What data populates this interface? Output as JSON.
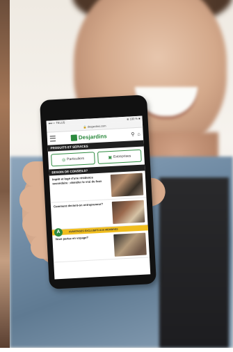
{
  "phone_screen": {
    "status_left": "●●○○ TELUS ",
    "status_right": "⊕ 100 % ■",
    "url": "🔒 desjardins.com",
    "brand": "Desjardins",
    "products_header": "PRODUITS ET SERVICES",
    "segments": [
      {
        "label": "Particuliers",
        "icon": "person-icon"
      },
      {
        "label": "Entreprises",
        "icon": "briefcase-icon"
      }
    ],
    "advice_header": "BESOIN DE CONSEILS?",
    "articles": [
      {
        "title": "Impôt et logé d'une résidence secondaire : démêler le vrai du faux"
      },
      {
        "title": "Comment devient-on entrepreneur?"
      },
      {
        "title": "Vous partez en voyage?"
      }
    ],
    "banner_badge": "A",
    "banner_text": "AVANTAGES EXCLUSIFS AUX MEMBRES",
    "colors": {
      "brand_green": "#2c8a3e",
      "banner_yellow": "#f0bd1e"
    }
  }
}
